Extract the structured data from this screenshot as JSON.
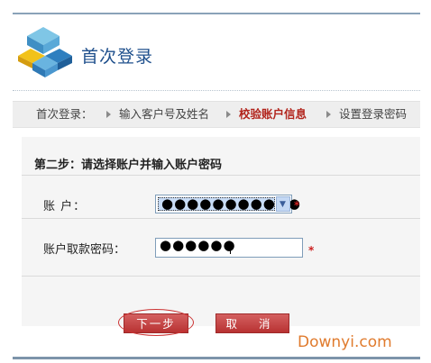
{
  "header": {
    "title": "首次登录",
    "logo_icon": "stacked-blocks-logo-icon"
  },
  "steps": [
    {
      "label": "首次登录：",
      "active": false
    },
    {
      "label": "输入客户号及姓名",
      "active": false
    },
    {
      "label": "校验账户信息",
      "active": true
    },
    {
      "label": "设置登录密码",
      "active": false
    }
  ],
  "form": {
    "heading": "第二步：请选择账户并输入账户密码",
    "account_label": "账 户：",
    "account_value": "●●●●●●●●●●●",
    "password_label": "账户取款密码：",
    "password_value": "●●●●●●",
    "required_mark": "*"
  },
  "buttons": {
    "next_label": "下一步",
    "cancel_label": "取 消"
  },
  "watermark": "Downyi.com",
  "colors": {
    "title": "#1e4f8c",
    "active_step": "#b2241c",
    "button": "#c04040",
    "required": "#cc2020"
  }
}
